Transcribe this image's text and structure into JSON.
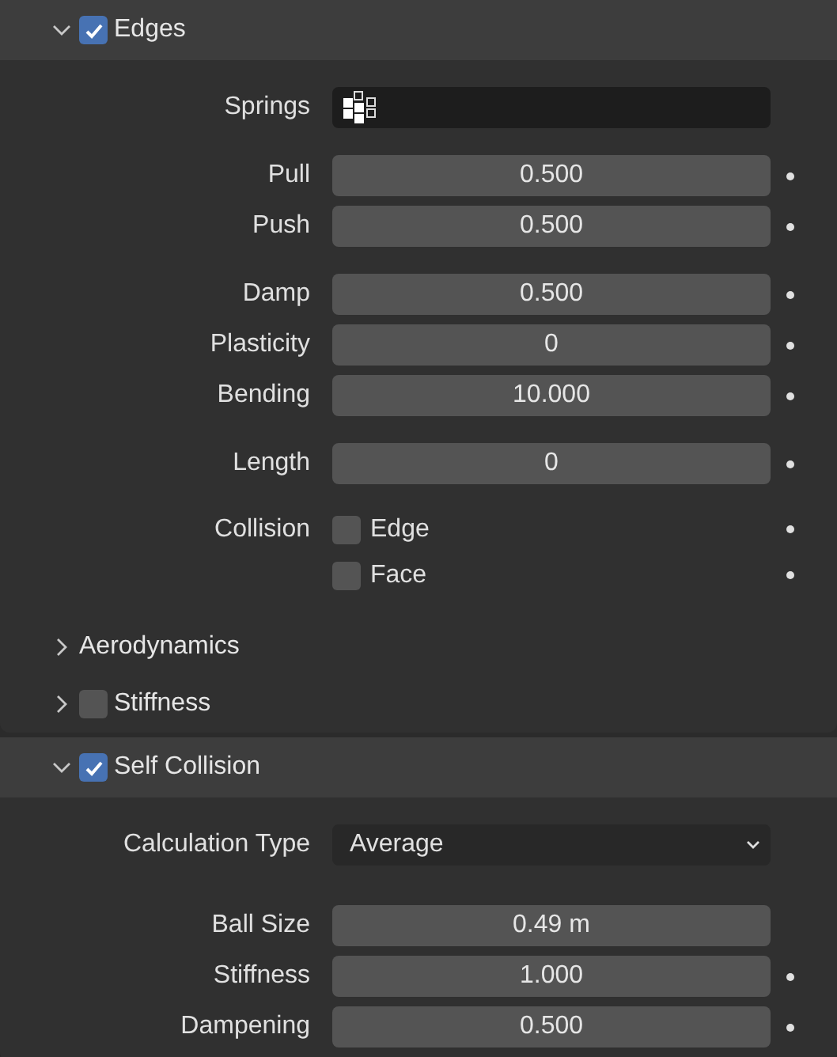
{
  "panels": [
    {
      "title": "Edges",
      "checked": true,
      "expanded": true,
      "groups": [
        [
          {
            "kind": "search",
            "label": "Springs"
          }
        ],
        [
          {
            "kind": "number",
            "label": "Pull",
            "value": "0.500",
            "keyframe_dot": true
          },
          {
            "kind": "number",
            "label": "Push",
            "value": "0.500",
            "keyframe_dot": true
          }
        ],
        [
          {
            "kind": "number",
            "label": "Damp",
            "value": "0.500",
            "keyframe_dot": true
          },
          {
            "kind": "number",
            "label": "Plasticity",
            "value": "0",
            "keyframe_dot": true
          },
          {
            "kind": "number",
            "label": "Bending",
            "value": "10.000",
            "keyframe_dot": true
          }
        ],
        [
          {
            "kind": "number",
            "label": "Length",
            "value": "0",
            "keyframe_dot": true
          }
        ],
        [
          {
            "kind": "checkbox",
            "label": "Collision",
            "value": "Edge",
            "checked": false,
            "keyframe_dot": true
          },
          {
            "kind": "checkbox",
            "value": "Face",
            "checked": false,
            "keyframe_dot": true
          }
        ]
      ],
      "subpanels": [
        {
          "title": "Aerodynamics",
          "expanded": false
        },
        {
          "title": "Stiffness",
          "expanded": false,
          "checked": false
        }
      ]
    },
    {
      "title": "Self Collision",
      "checked": true,
      "expanded": true,
      "groups": [
        [
          {
            "kind": "dropdown",
            "label": "Calculation Type",
            "value": "Average"
          }
        ],
        [
          {
            "kind": "number",
            "label": "Ball Size",
            "value": "0.49 m",
            "keyframe_dot": false
          },
          {
            "kind": "number",
            "label": "Stiffness",
            "value": "1.000",
            "keyframe_dot": true
          },
          {
            "kind": "number",
            "label": "Dampening",
            "value": "0.500",
            "keyframe_dot": true
          }
        ]
      ]
    }
  ]
}
